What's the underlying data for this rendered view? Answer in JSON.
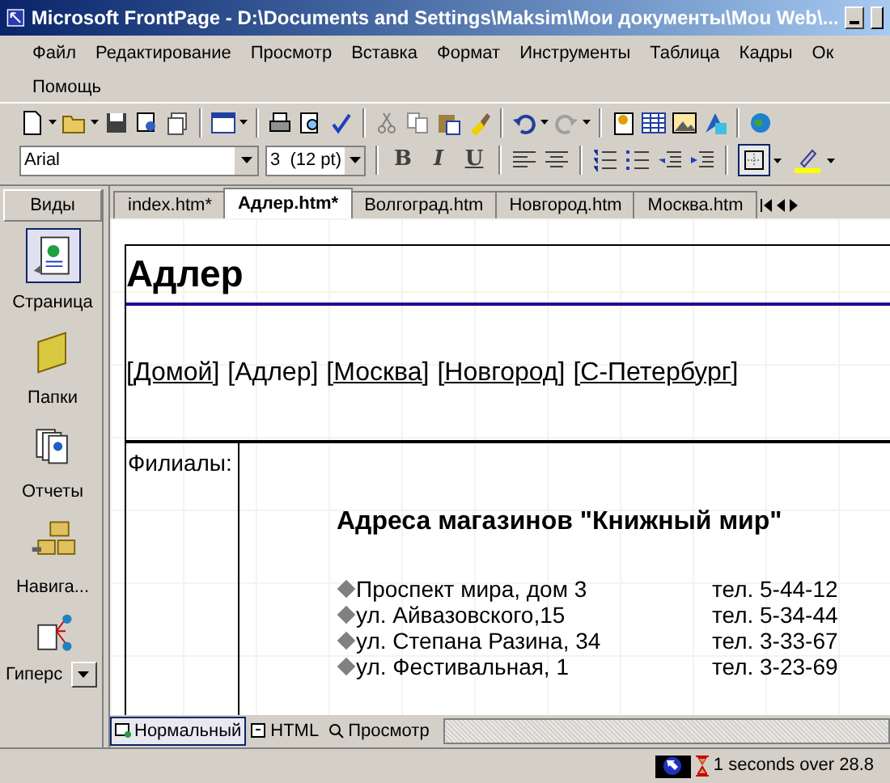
{
  "window": {
    "title": "Microsoft FrontPage - D:\\Documents and Settings\\Maksim\\Мои документы\\Mou Web\\..."
  },
  "menu": [
    "Файл",
    "Редактирование",
    "Просмотр",
    "Вставка",
    "Формат",
    "Инструменты",
    "Таблица",
    "Кадры",
    "Ок",
    "Помощь"
  ],
  "format_bar": {
    "font": "Arial",
    "size": "3  (12 pt)",
    "style_buttons": [
      "B",
      "I",
      "U"
    ]
  },
  "views": {
    "title": "Виды",
    "items": [
      {
        "label": "Страница",
        "selected": true
      },
      {
        "label": "Папки",
        "selected": false
      },
      {
        "label": "Отчеты",
        "selected": false
      },
      {
        "label": "Навига...",
        "selected": false
      },
      {
        "label": "Гиперс",
        "selected": false
      }
    ]
  },
  "tabs": [
    {
      "label": "index.htm*",
      "selected": false
    },
    {
      "label": "Адлер.htm*",
      "selected": true
    },
    {
      "label": "Волгоград.htm",
      "selected": false
    },
    {
      "label": "Новгород.htm",
      "selected": false
    },
    {
      "label": "Москва.htm",
      "selected": false
    }
  ],
  "page": {
    "heading": "Адлер",
    "nav": [
      {
        "text": "[Домой]",
        "link": true
      },
      {
        "text": "[Адлер]",
        "link": false
      },
      {
        "text": "[Москва]",
        "link": true
      },
      {
        "text": "[Новгород]",
        "link": true
      },
      {
        "text": "[С-Петербург]",
        "link": true
      }
    ],
    "side_cell": "Филиалы:",
    "subheading": "Адреса магазинов \"Книжный мир\"",
    "addresses": [
      {
        "address": "Проспект мира, дом 3",
        "phone": "тел. 5-44-12"
      },
      {
        "address": "ул. Айвазовского,15",
        "phone": "тел. 5-34-44"
      },
      {
        "address": "ул. Степана Разина, 34",
        "phone": "тел. 3-33-67"
      },
      {
        "address": "ул. Фестивальная, 1",
        "phone": "тел. 3-23-69"
      }
    ]
  },
  "view_tabs": [
    {
      "label": "Нормальный",
      "selected": true
    },
    {
      "label": "HTML",
      "selected": false
    },
    {
      "label": "Просмотр",
      "selected": false
    }
  ],
  "status_bar": {
    "text": "1 seconds over 28.8"
  }
}
